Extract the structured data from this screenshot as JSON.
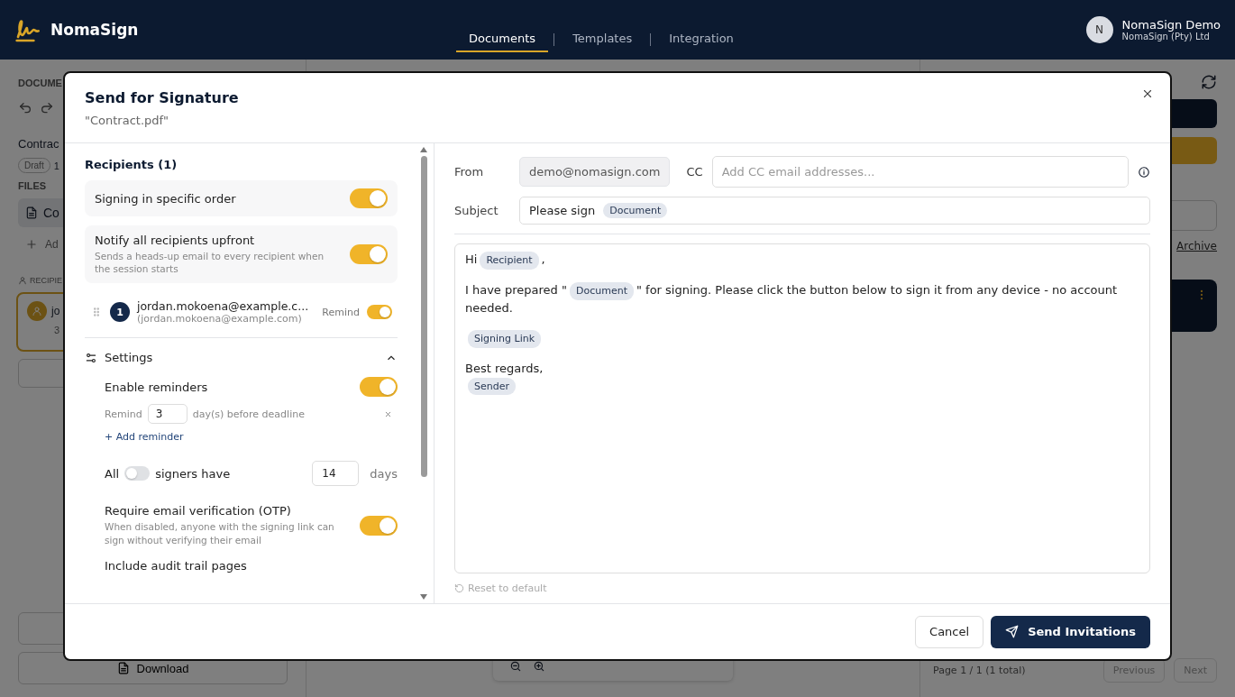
{
  "app": {
    "brand": "NomaSign",
    "nav": [
      {
        "label": "Documents",
        "selected": true
      },
      {
        "label": "Templates",
        "selected": false
      },
      {
        "label": "Integration",
        "selected": false
      }
    ],
    "user": {
      "initial": "N",
      "name": "NomaSign Demo",
      "org": "NomaSign (Pty) Ltd"
    }
  },
  "background": {
    "left": {
      "section": "DOCUME",
      "doc_title": "Contrac",
      "status": "Draft",
      "count": "1",
      "files_label": "FILES",
      "file": "Co",
      "add": "Ad",
      "recipients_label": "RECIPIE",
      "recipient": "jo",
      "recipient_meta": "3",
      "download": "Download"
    },
    "right": {
      "archive": "Archive",
      "pagination": "Page 1 / 1 (1 total)",
      "previous": "Previous",
      "next": "Next"
    }
  },
  "modal": {
    "title": "Send for Signature",
    "subtitle": "\"Contract.pdf\"",
    "recipients_heading": "Recipients (1)",
    "options": [
      {
        "label": "Signing in specific order",
        "on": true
      },
      {
        "label": "Notify all recipients upfront",
        "hint": "Sends a heads-up email to every recipient when the session starts",
        "on": true
      }
    ],
    "recipients": [
      {
        "order": "1",
        "name": "jordan.mokoena@example.c...",
        "email": "(jordan.mokoena@example.com)",
        "remind_label": "Remind",
        "remind": true
      }
    ],
    "settings": {
      "title": "Settings",
      "expanded": true,
      "reminders": {
        "label": "Enable reminders",
        "on": true,
        "prefix": "Remind",
        "days": "3",
        "suffix": "day(s) before deadline",
        "add": "+ Add reminder"
      },
      "deadline": {
        "before": "All",
        "on": false,
        "after": "signers have",
        "days": "14",
        "unit": "days"
      },
      "otp": {
        "label": "Require email verification (OTP)",
        "hint": "When disabled, anyone with the signing link can sign without verifying their email",
        "on": true
      },
      "audit": {
        "label": "Include audit trail pages"
      }
    },
    "email": {
      "from_label": "From",
      "from": "demo@nomasign.com",
      "cc_label": "CC",
      "cc_placeholder": "Add CC email addresses...",
      "subject_label": "Subject",
      "subject": [
        {
          "kind": "text",
          "text": "Please sign"
        },
        {
          "kind": "chip",
          "text": "Document"
        }
      ],
      "body": [
        [
          {
            "kind": "text",
            "text": "Hi"
          },
          {
            "kind": "chip",
            "text": "Recipient"
          },
          {
            "kind": "text",
            "text": ","
          }
        ],
        [
          {
            "kind": "text",
            "text": "I have prepared \""
          },
          {
            "kind": "chip",
            "text": "Document"
          },
          {
            "kind": "text",
            "text": "\" for signing. Please click the button below to sign it from any device - no account needed."
          }
        ],
        [
          {
            "kind": "chip",
            "text": "Signing Link"
          }
        ],
        [
          {
            "kind": "text",
            "text": "Best regards,"
          },
          {
            "kind": "break"
          },
          {
            "kind": "chip",
            "text": "Sender"
          }
        ]
      ],
      "reset": "Reset to default"
    },
    "buttons": {
      "cancel": "Cancel",
      "send": "Send Invitations"
    }
  }
}
